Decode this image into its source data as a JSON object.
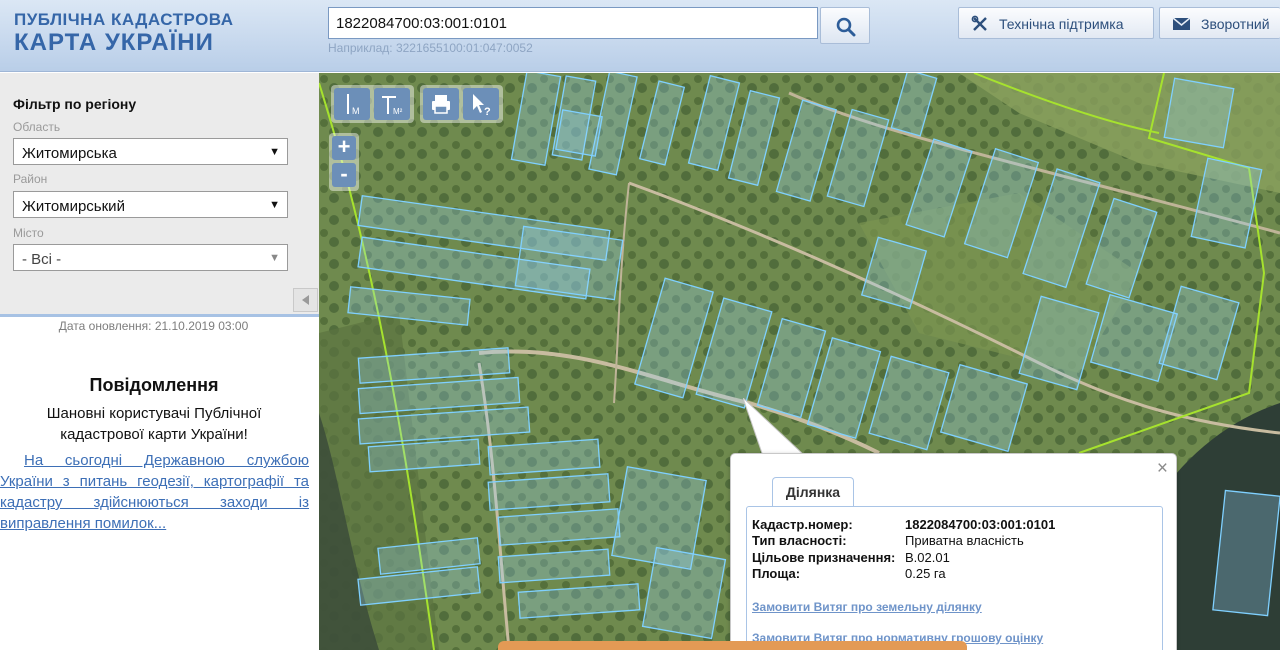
{
  "header": {
    "logo_line1": "ПУБЛІЧНА КАДАСТРОВА",
    "logo_line2": "КАРТА УКРАЇНИ",
    "search_value": "1822084700:03:001:0101",
    "example_text": "Наприклад: 3221655100:01:047:0052",
    "support_label": "Технічна підтримка",
    "feedback_label": "Зворотний"
  },
  "sidebar": {
    "filter_title": "Фільтр по регіону",
    "oblast_label": "Область",
    "oblast_value": "Житомирська",
    "raion_label": "Район",
    "raion_value": "Житомирський",
    "misto_label": "Місто",
    "misto_value": "- Всі -",
    "updated_text": "Дата оновлення: 21.10.2019 03:00",
    "message_title": "Повідомлення",
    "message_greeting": "Шановні користувачі Публічної кадастрової карти України!",
    "message_link": "На сьогодні Державною службою України з питань геодезії, картографії та кадастру здійснюються заходи із виправлення помилок..."
  },
  "map": {
    "tools": [
      {
        "name": "measure-length-icon",
        "label": "М"
      },
      {
        "name": "measure-area-icon",
        "label": "М²"
      },
      {
        "name": "print-icon",
        "label": ""
      },
      {
        "name": "identify-icon",
        "label": "?"
      }
    ],
    "zoom_in": "+",
    "zoom_out": "-"
  },
  "popup": {
    "tab_label": "Ділянка",
    "close_symbol": "×",
    "rows": [
      {
        "key": "Кадастр.номер:",
        "value": "1822084700:03:001:0101"
      },
      {
        "key": "Тип власності:",
        "value": "Приватна власність"
      },
      {
        "key": "Цільове призначення:",
        "value": "В.02.01"
      },
      {
        "key": "Площа:",
        "value": "0.25 га"
      }
    ],
    "link1": "Замовити Витяг про земельну ділянку",
    "link2": "Замовити Витяг про нормативну грошову оцінку"
  },
  "colors": {
    "header_blue": "#3566a8",
    "parcel_outline": "#7fd0ff",
    "boundary_line": "#a6e22e",
    "link_blue": "#3d6fb6",
    "tool_blue": "#6c8fb8"
  }
}
